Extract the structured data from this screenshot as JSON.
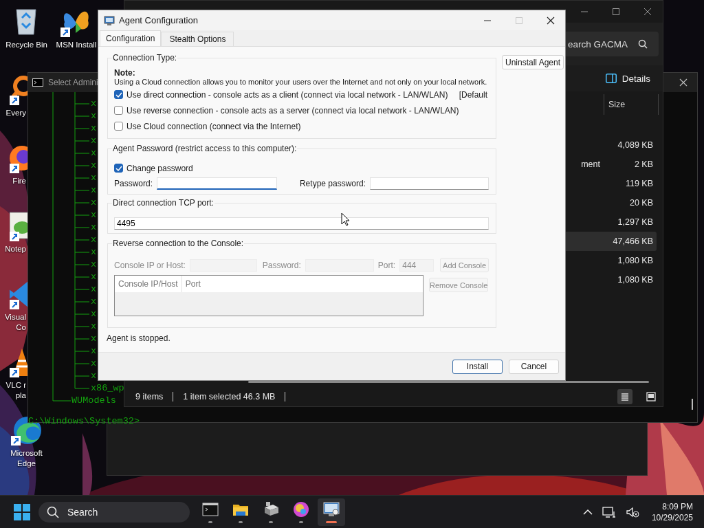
{
  "desktop": {
    "columns": [
      [
        {
          "kind": "recycle-bin",
          "lines": [
            "Recycle Bin"
          ],
          "shortcut": false,
          "covered": false
        },
        {
          "kind": "search-ring",
          "lines": [
            "Every"
          ],
          "shortcut": true,
          "covered": true
        },
        {
          "kind": "fox",
          "lines": [
            "Fire"
          ],
          "shortcut": true,
          "covered": true
        },
        {
          "kind": "notepad",
          "lines": [
            "Notep"
          ],
          "shortcut": true,
          "covered": true
        },
        {
          "kind": "code",
          "lines": [
            "Visual",
            "Co"
          ],
          "shortcut": true,
          "covered": true
        },
        {
          "kind": "cone",
          "lines": [
            "VLC r",
            "pla"
          ],
          "shortcut": true,
          "covered": true
        },
        {
          "kind": "edge",
          "lines": [
            "Microsoft",
            "Edge"
          ],
          "shortcut": true,
          "covered": false
        }
      ],
      [
        {
          "kind": "butterfly",
          "lines": [
            "MSN Install"
          ],
          "shortcut": true,
          "covered": false
        }
      ]
    ]
  },
  "console_window": {
    "title": "Select Admini",
    "tree_items": [
      "x",
      "x",
      "x",
      "x",
      "x",
      "x",
      "x",
      "x",
      "x",
      "x",
      "x",
      "x",
      "x",
      "x",
      "x",
      "x",
      "x",
      "x",
      "x",
      "x",
      "x",
      "x",
      "x"
    ],
    "last_item": "x86_wp",
    "folder": "WUModels",
    "prompt": "C:\\Windows\\System32>"
  },
  "explorer_window": {
    "search": {
      "value": "earch GACMA"
    },
    "details_button": "Details",
    "columns": [
      "Size"
    ],
    "rows": [
      {
        "size": "4,089 KB",
        "selected": false
      },
      {
        "name": "ment",
        "size": "2 KB",
        "selected": false
      },
      {
        "size": "119 KB",
        "selected": false
      },
      {
        "size": "20 KB",
        "selected": false
      },
      {
        "size": "1,297 KB",
        "selected": false
      },
      {
        "size": "47,466 KB",
        "selected": true
      },
      {
        "size": "1,080 KB",
        "selected": false
      },
      {
        "size": "1,080 KB",
        "selected": false
      }
    ],
    "status_bar": {
      "items": "9 items",
      "selection": "1 item selected  46.3 MB"
    },
    "views": [
      {
        "kind": "details",
        "selected": true
      },
      {
        "kind": "tiles",
        "selected": false
      }
    ]
  },
  "dialog": {
    "title": "Agent Configuration",
    "tabs": [
      {
        "label": "Configuration",
        "selected": true
      },
      {
        "label": "Stealth Options",
        "selected": false
      }
    ],
    "connection_type": {
      "legend": "Connection Type:",
      "note_heading": "Note:",
      "note": "Using a Cloud connection allows you to monitor your users over the Internet and not only on your local network.",
      "options": [
        {
          "label": "Use direct connection - console acts as a client (connect via local network - LAN/WLAN)",
          "checked": true,
          "tag": "[Default"
        },
        {
          "label": "Use reverse connection - console acts as a server (connect via local network - LAN/WLAN)",
          "checked": false
        },
        {
          "label": "Use Cloud connection (connect via the Internet)",
          "checked": false
        }
      ]
    },
    "uninstall_button": "Uninstall Agent",
    "password_group": {
      "legend": "Agent Password (restrict access to this computer):",
      "change_password": {
        "label": "Change password",
        "checked": true
      },
      "password_label": "Password:",
      "password_focused": true,
      "retype_label": "Retype password:"
    },
    "port_group": {
      "legend": "Direct connection TCP port:",
      "value": "4495"
    },
    "reverse_group": {
      "legend": "Reverse connection to the Console:",
      "disabled": true,
      "host_label": "Console IP or Host:",
      "password_label": "Password:",
      "port_label": "Port:",
      "port_value": "444",
      "add_button": "Add Console",
      "remove_button": "Remove Console",
      "columns": [
        "Console IP/Host",
        "Port"
      ]
    },
    "status": "Agent is stopped.",
    "buttons": [
      {
        "label": "Install",
        "default": true
      },
      {
        "label": "Cancel",
        "default": false
      }
    ]
  },
  "taskbar": {
    "search": "Search",
    "apps": [
      {
        "kind": "terminal",
        "selected": false
      },
      {
        "kind": "folder",
        "selected": false
      },
      {
        "kind": "device",
        "selected": false
      },
      {
        "kind": "orb",
        "selected": false
      },
      {
        "kind": "agent",
        "selected": true
      }
    ],
    "clock": {
      "time": "8:09 PM",
      "date": "10/29/2025"
    }
  }
}
